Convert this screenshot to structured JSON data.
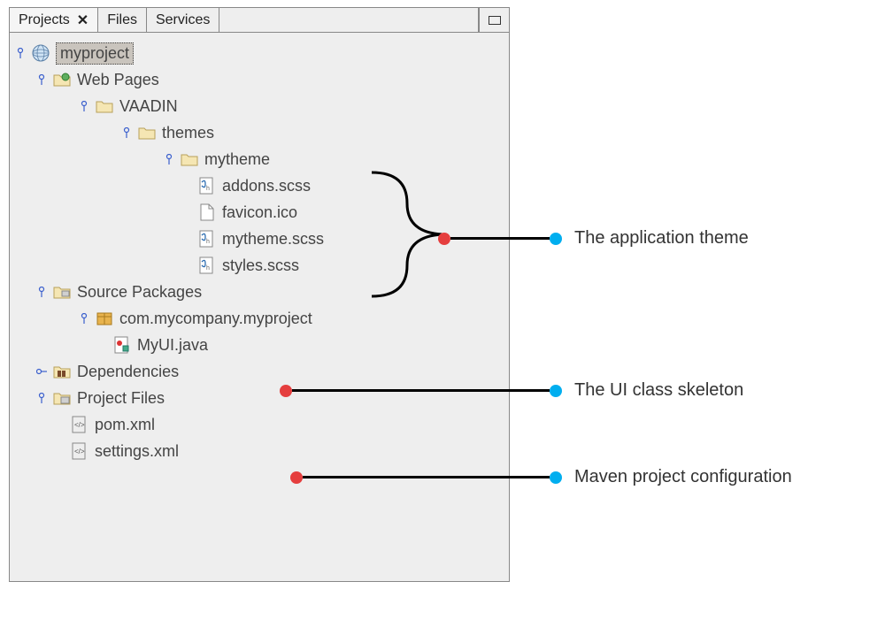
{
  "tabs": {
    "active": "Projects",
    "t1": "Projects",
    "t2": "Files",
    "t3": "Services"
  },
  "tree": {
    "root": "myproject",
    "webpages": "Web Pages",
    "vaadin": "VAADIN",
    "themes": "themes",
    "mytheme": "mytheme",
    "addons": "addons.scss",
    "favicon": "favicon.ico",
    "mythemescss": "mytheme.scss",
    "stylesscss": "styles.scss",
    "srcpkg": "Source Packages",
    "pkg": "com.mycompany.myproject",
    "uiclass": "MyUI.java",
    "deps": "Dependencies",
    "projfiles": "Project Files",
    "pom": "pom.xml",
    "settings": "settings.xml"
  },
  "annotations": {
    "theme": "The application theme",
    "ui": "The UI class skeleton",
    "maven": "Maven project configuration"
  }
}
